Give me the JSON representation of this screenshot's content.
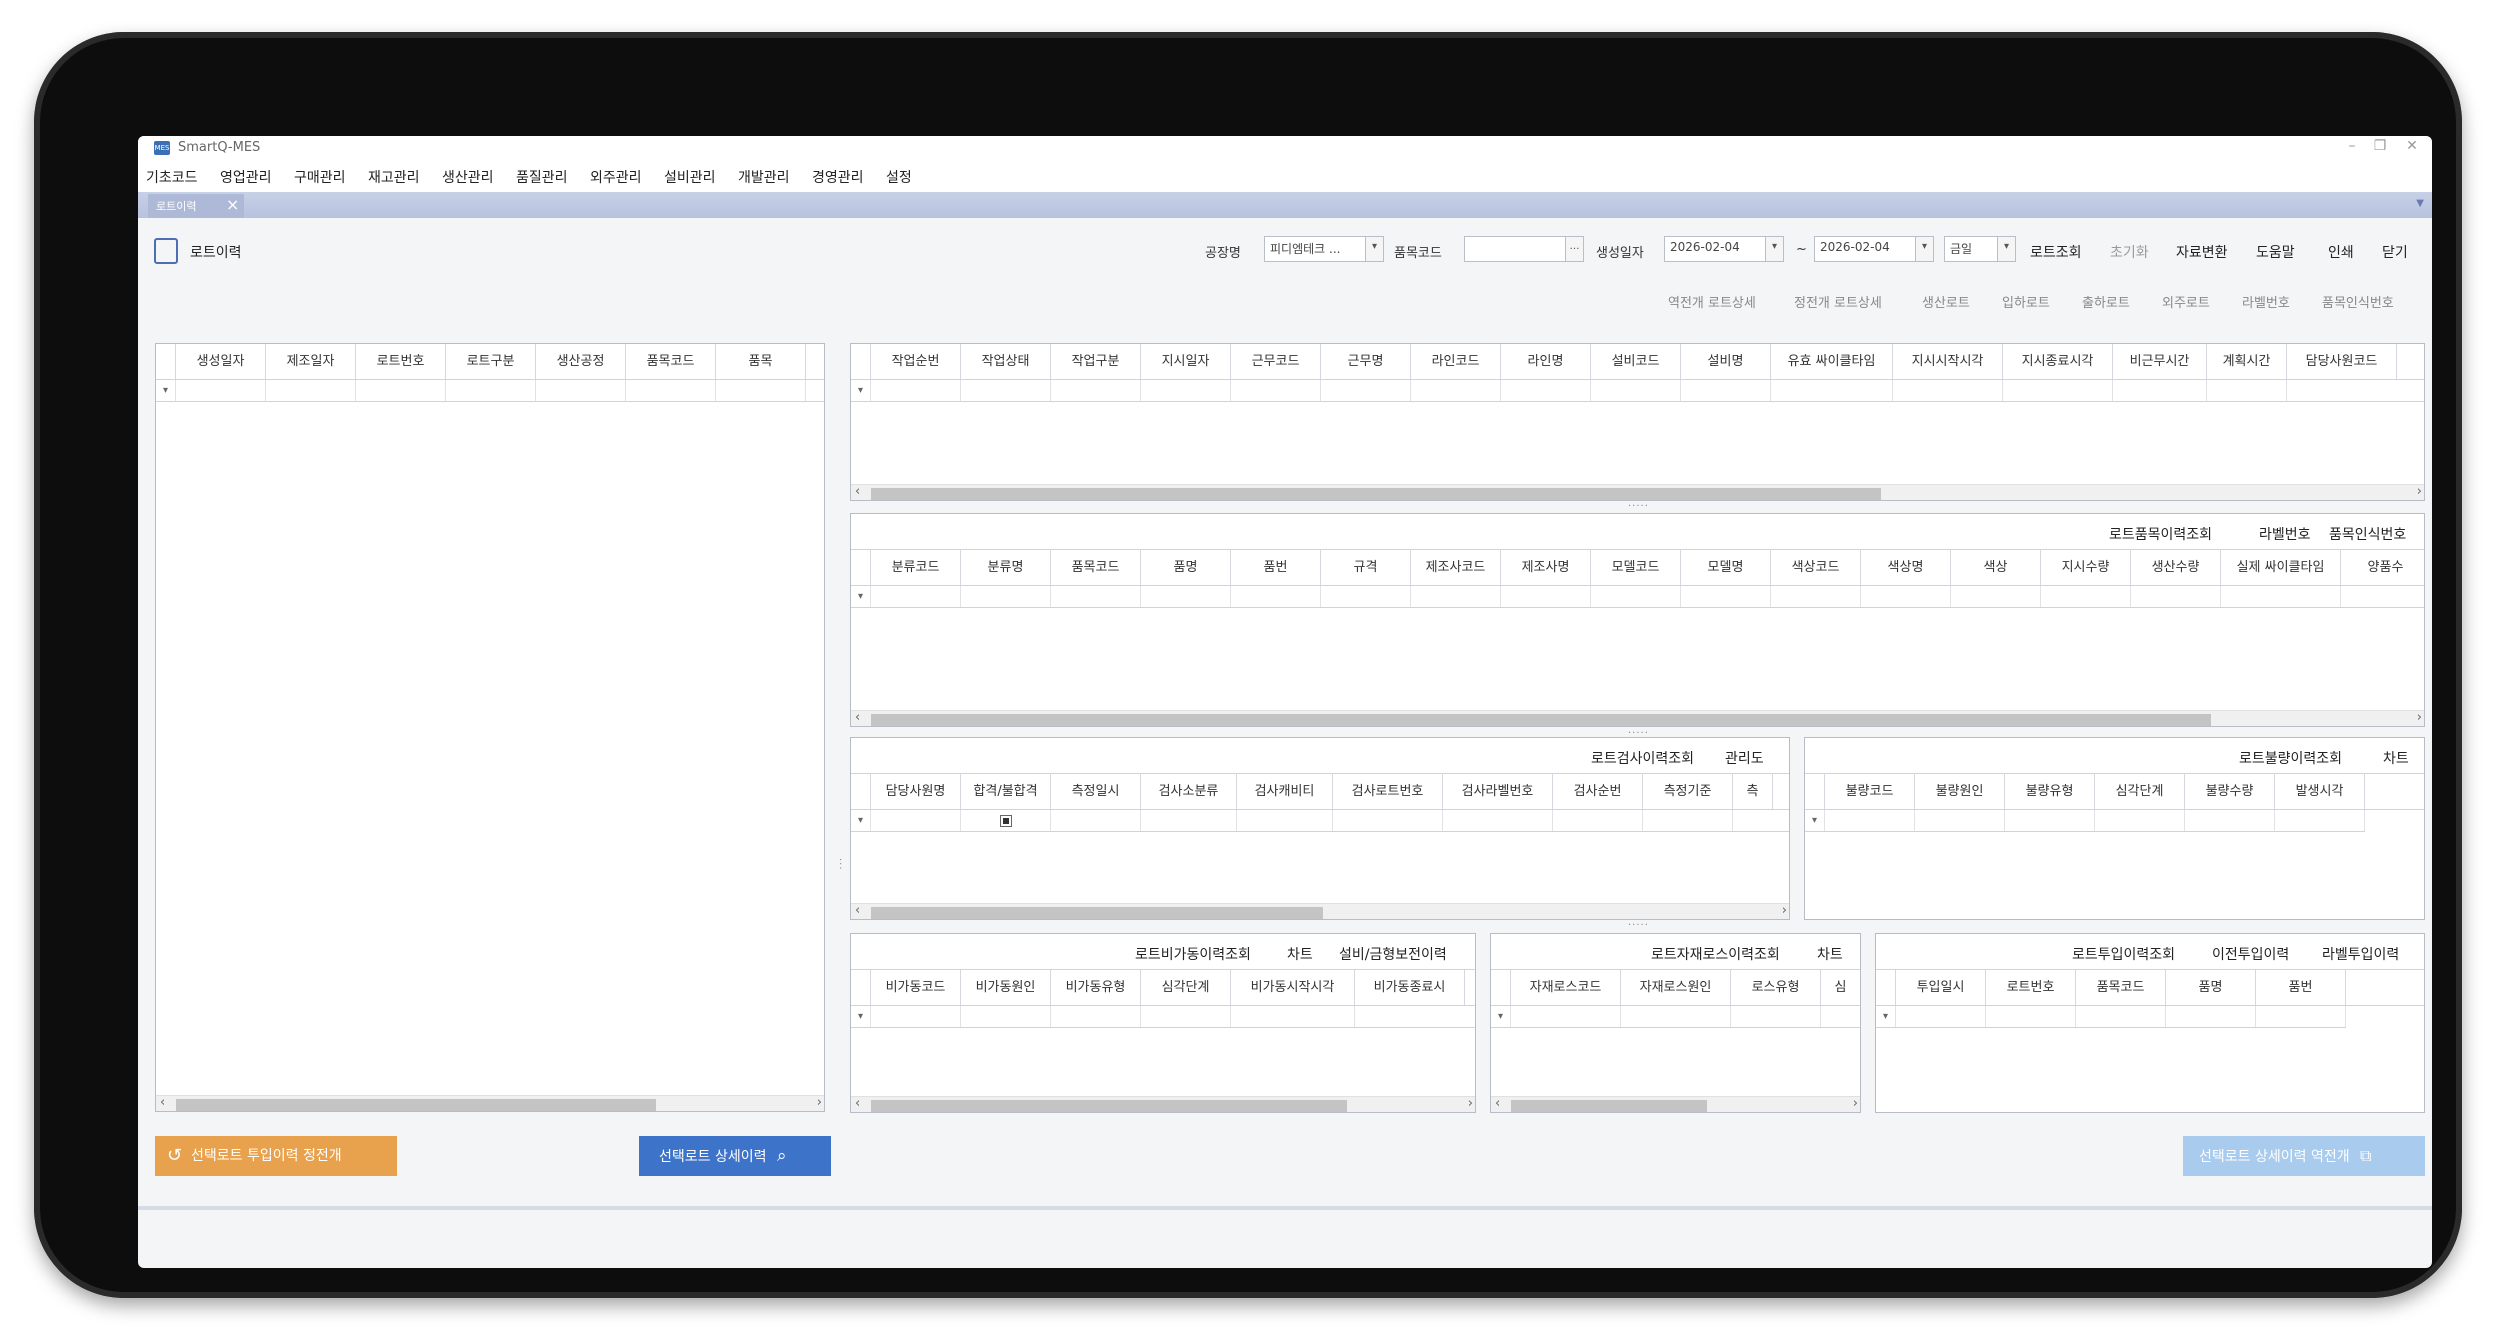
{
  "window": {
    "title": "SmartQ-MES"
  },
  "menu": [
    "기초코드",
    "영업관리",
    "구매관리",
    "재고관리",
    "생산관리",
    "품질관리",
    "외주관리",
    "설비관리",
    "개발관리",
    "경영관리",
    "설정"
  ],
  "tab": {
    "label": "로트이력"
  },
  "page": {
    "title": "로트이력"
  },
  "filters": {
    "factory_label": "공장명",
    "factory_value": "피디엠테크 ...",
    "item_code_label": "품목코드",
    "item_code_value": "",
    "date_label": "생성일자",
    "date_from": "2026-02-04",
    "tilde": "~",
    "date_to": "2026-02-04",
    "period": "금일"
  },
  "toolbar": {
    "query": "로트조회",
    "reset": "초기화",
    "convert": "자료변환",
    "help": "도움말",
    "print": "인쇄",
    "close": "닫기"
  },
  "subtoolbar": [
    "역전개 로트상세",
    "정전개 로트상세",
    "생산로트",
    "입하로트",
    "출하로트",
    "외주로트",
    "라벨번호",
    "품목인식번호"
  ],
  "left_grid": {
    "columns": [
      "생성일자",
      "제조일자",
      "로트번호",
      "로트구분",
      "생산공정",
      "품목코드",
      "품목"
    ]
  },
  "work_grid": {
    "columns": [
      "작업순번",
      "작업상태",
      "작업구분",
      "지시일자",
      "근무코드",
      "근무명",
      "라인코드",
      "라인명",
      "설비코드",
      "설비명",
      "유효 싸이클타임",
      "지시시작시각",
      "지시종료시각",
      "비근무시간",
      "계획시간",
      "담당사원코드"
    ]
  },
  "item_history": {
    "buttons": [
      "로트품목이력조회",
      "라벨번호",
      "품목인식번호"
    ],
    "columns": [
      "분류코드",
      "분류명",
      "품목코드",
      "품명",
      "품번",
      "규격",
      "제조사코드",
      "제조사명",
      "모델코드",
      "모델명",
      "색상코드",
      "색상명",
      "색상",
      "지시수량",
      "생산수량",
      "실제 싸이클타임",
      "양품수"
    ]
  },
  "inspection": {
    "buttons": [
      "로트검사이력조회",
      "관리도"
    ],
    "columns": [
      "담당사원명",
      "합격/불합격",
      "측정일시",
      "검사소분류",
      "검사캐비티",
      "검사로트번호",
      "검사라벨번호",
      "검사순번",
      "측정기준",
      "측"
    ]
  },
  "defect": {
    "buttons": [
      "로트불량이력조회",
      "차트"
    ],
    "columns": [
      "불량코드",
      "불량원인",
      "불량유형",
      "심각단계",
      "불량수량",
      "발생시각"
    ]
  },
  "nonop": {
    "buttons": [
      "로트비가동이력조회",
      "차트",
      "설비/금형보전이력"
    ],
    "columns": [
      "비가동코드",
      "비가동원인",
      "비가동유형",
      "심각단계",
      "비가동시작시각",
      "비가동종료시"
    ]
  },
  "loss": {
    "buttons": [
      "로트자재로스이력조회",
      "차트"
    ],
    "columns": [
      "자재로스코드",
      "자재로스원인",
      "로스유형",
      "심"
    ]
  },
  "input": {
    "buttons": [
      "로트투입이력조회",
      "이전투입이력",
      "라벨투입이력"
    ],
    "columns": [
      "투입일시",
      "로트번호",
      "품목코드",
      "품명",
      "품번"
    ]
  },
  "actions": {
    "forward_input": "선택로트 투입이력 정전개",
    "detail": "선택로트 상세이력",
    "reverse_detail": "선택로트 상세이력 역전개"
  },
  "icons": {
    "app": "app-icon",
    "page": "clipboard-search-icon"
  },
  "colors": {
    "accent": "#3d74c9",
    "orange": "#e8a24d",
    "light_blue": "#a8cbee"
  }
}
